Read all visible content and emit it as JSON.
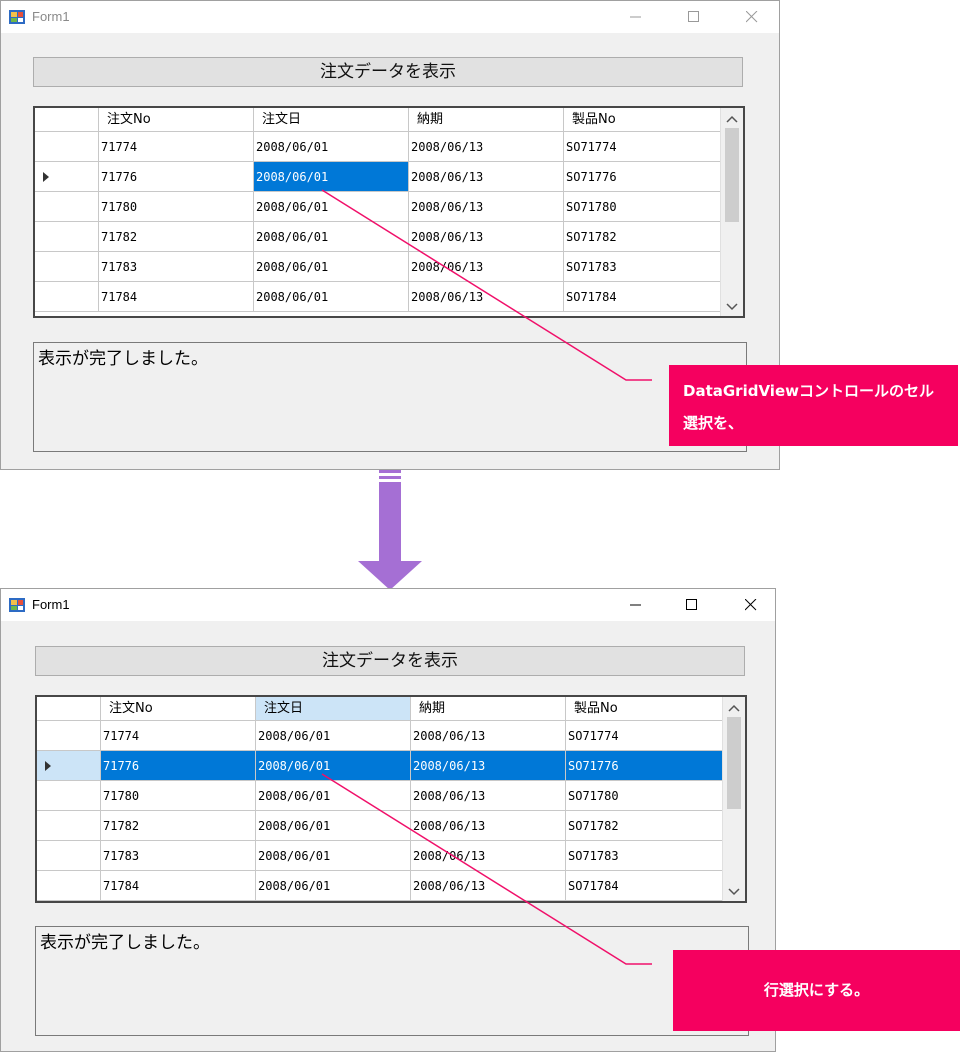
{
  "colors": {
    "accent": "#0078d7",
    "highlight": "#cce4f7",
    "callout": "#f5005f",
    "arrow": "#a56fd4",
    "leader_line": "#f0106a"
  },
  "icons": {
    "app": "form-icon",
    "minimize": "minimize-icon",
    "maximize": "maximize-icon",
    "close": "close-icon",
    "row_pointer": "row-indicator-icon",
    "down_arrow": "arrow-down-icon"
  },
  "columns": [
    "注文No",
    "注文日",
    "納期",
    "製品No"
  ],
  "rows": [
    [
      "71774",
      "2008/06/01",
      "2008/06/13",
      "SO71774"
    ],
    [
      "71776",
      "2008/06/01",
      "2008/06/13",
      "SO71776"
    ],
    [
      "71780",
      "2008/06/01",
      "2008/06/13",
      "SO71780"
    ],
    [
      "71782",
      "2008/06/01",
      "2008/06/13",
      "SO71782"
    ],
    [
      "71783",
      "2008/06/01",
      "2008/06/13",
      "SO71783"
    ],
    [
      "71784",
      "2008/06/01",
      "2008/06/13",
      "SO71784"
    ]
  ],
  "before": {
    "window_title": "Form1",
    "button_label": "注文データを表示",
    "status_text": "表示が完了しました。",
    "callout_text": "DataGridViewコントロールのセル選択を、"
  },
  "after": {
    "window_title": "Form1",
    "button_label": "注文データを表示",
    "status_text": "表示が完了しました。",
    "callout_text": "行選択にする。"
  }
}
